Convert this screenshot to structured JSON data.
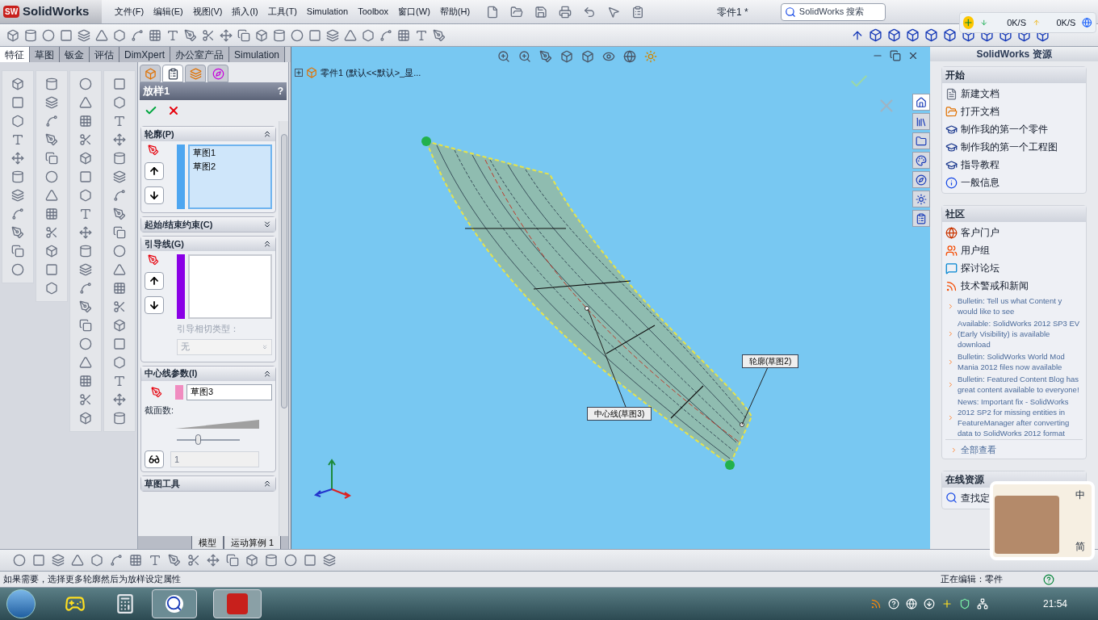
{
  "app": {
    "logo_mark": "SW",
    "logo": "SolidWorks",
    "document_title": "零件1 *"
  },
  "menu": [
    "文件(F)",
    "编辑(E)",
    "视图(V)",
    "插入(I)",
    "工具(T)",
    "Simulation",
    "Toolbox",
    "窗口(W)",
    "帮助(H)"
  ],
  "search": {
    "placeholder": "SolidWorks 搜索"
  },
  "net_monitor": {
    "down": "0K/S",
    "up": "0K/S"
  },
  "command_tabs": [
    {
      "label": "特征",
      "selected": true
    },
    {
      "label": "草图",
      "selected": false
    },
    {
      "label": "钣金",
      "selected": false
    },
    {
      "label": "评估",
      "selected": false
    },
    {
      "label": "DimXpert",
      "selected": false
    },
    {
      "label": "办公室产品",
      "selected": false
    },
    {
      "label": "Simulation",
      "selected": false
    }
  ],
  "panel_tabs": [
    {
      "kind": "feature-tree",
      "selected": false
    },
    {
      "kind": "property",
      "selected": true
    },
    {
      "kind": "configuration",
      "selected": false
    },
    {
      "kind": "dimxpert",
      "selected": false
    }
  ],
  "property_manager": {
    "title": "放样1",
    "help": "?",
    "sections": [
      {
        "kind": "selection",
        "title": "轮廓(P)",
        "expanded": true,
        "color": "#4ea6f0",
        "active": true,
        "items": [
          "草图1",
          "草图2"
        ]
      },
      {
        "kind": "header",
        "title": "起始/结束约束(C)",
        "expanded": false
      },
      {
        "kind": "selection",
        "title": "引导线(G)",
        "expanded": true,
        "color": "#8a00e6",
        "active": false,
        "tangency": {
          "label": "引导相切类型：",
          "value": "无",
          "disabled": true
        }
      },
      {
        "kind": "centerline",
        "title": "中心线参数(I)",
        "expanded": true,
        "color": "#f08cc0",
        "value": "草图3",
        "count_label": "截面数:",
        "level": 0.33,
        "count": "1"
      },
      {
        "kind": "header",
        "title": "草图工具",
        "expanded": true
      }
    ]
  },
  "bottom_tabs": [
    "模型",
    "运动算例 1"
  ],
  "viewport": {
    "tree_label": "零件1  (默认<<默认>_显...",
    "callouts": [
      {
        "kind": "centerline",
        "label": "中心线(草图3)"
      },
      {
        "kind": "profile",
        "label": "轮廓(草图2)"
      }
    ]
  },
  "task_tabs": [
    {
      "kind": "home",
      "selected": true
    },
    {
      "kind": "library",
      "selected": false
    },
    {
      "kind": "folder",
      "selected": false
    },
    {
      "kind": "palette",
      "selected": false
    },
    {
      "kind": "explorer",
      "selected": false
    },
    {
      "kind": "appearance",
      "selected": false
    },
    {
      "kind": "properties",
      "selected": false
    }
  ],
  "task_pane": {
    "title": "SolidWorks 资源",
    "groups": [
      {
        "title": "开始",
        "items": [
          {
            "kind": "document",
            "label": "新建文档"
          },
          {
            "kind": "folder",
            "label": "打开文档"
          },
          {
            "kind": "tutorial",
            "label": "制作我的第一个零件"
          },
          {
            "kind": "tutorial",
            "label": "制作我的第一个工程图"
          },
          {
            "kind": "tutorial",
            "label": "指导教程"
          },
          {
            "kind": "info",
            "label": "一般信息"
          }
        ]
      },
      {
        "title": "社区",
        "items": [
          {
            "kind": "globe",
            "label": "客户门户"
          },
          {
            "kind": "users",
            "label": "用户组"
          },
          {
            "kind": "chat",
            "label": "探讨论坛"
          },
          {
            "kind": "rss",
            "label": "技术警戒和新闻"
          }
        ],
        "news": [
          "Bulletin: Tell us what Content y would like to see",
          "Available: SolidWorks 2012 SP3 EV (Early Visibility) is available download",
          "Bulletin: SolidWorks World Mod Mania 2012 files now available",
          "Bulletin: Featured Content Blog has great content available to everyone!",
          "News: Important fix - SolidWorks 2012 SP2 for missing entities in FeatureManager after converting data to SolidWorks 2012 format"
        ],
        "more": "全部查看"
      },
      {
        "title": "在线资源",
        "items": [
          {
            "kind": "search",
            "label": "查找定"
          }
        ]
      }
    ]
  },
  "ime_widget": {
    "mode": "中",
    "charset": "简"
  },
  "status_bar": {
    "hint": "如果需要，选择更多轮廓然后为放样设定属性",
    "mode": "正在编辑：零件"
  },
  "taskbar": {
    "clock": "21:54"
  }
}
